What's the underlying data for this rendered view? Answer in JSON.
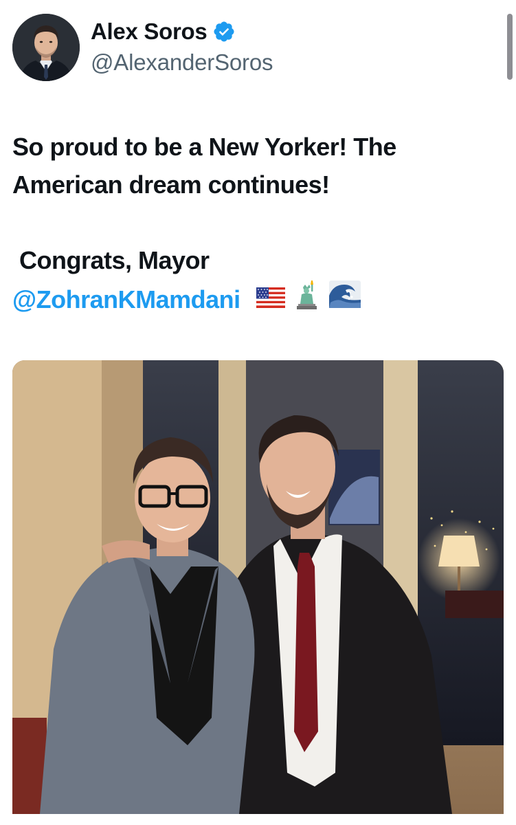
{
  "author": {
    "display_name": "Alex Soros",
    "handle": "@AlexanderSoros",
    "verified": true
  },
  "tweet": {
    "line1": "So proud to be a New Yorker! The",
    "line2": "American dream continues!",
    "line3": "Congrats, Mayor",
    "mention": "@ZohranKMamdani",
    "emojis": [
      "us-flag",
      "statue-of-liberty",
      "water-wave"
    ]
  },
  "colors": {
    "accent": "#1d9bf0",
    "secondary_text": "#536471",
    "primary_text": "#0f1419"
  }
}
